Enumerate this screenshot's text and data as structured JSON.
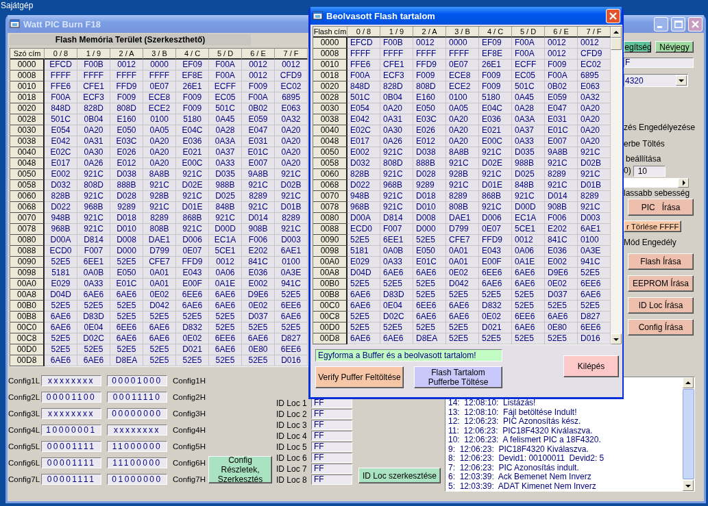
{
  "desktop": {
    "icon_label": "Sajátgép"
  },
  "main_window": {
    "title": "Watt PIC Burn F18",
    "active": false,
    "flash_area": {
      "title": "Flash Memória Terület (Szerkeszthető)",
      "columns": [
        "Szó cím",
        "0 / 8",
        "1 / 9",
        "2 / A",
        "3 / B",
        "4 / C",
        "5 / D",
        "6 / E",
        "7 / F"
      ],
      "rows": [
        {
          "cells": [
            "0000",
            "EFCD",
            "F00B",
            "0012",
            "0000",
            "EF09",
            "F00A",
            "0012",
            "0012"
          ]
        },
        {
          "cells": [
            "0008",
            "FFFF",
            "FFFF",
            "FFFF",
            "FFFF",
            "EF8E",
            "F00A",
            "0012",
            "CFD9"
          ]
        },
        {
          "cells": [
            "0010",
            "FFE6",
            "CFE1",
            "FFD9",
            "0E07",
            "26E1",
            "ECFF",
            "F009",
            "EC02"
          ]
        },
        {
          "cells": [
            "0018",
            "F00A",
            "ECF3",
            "F009",
            "ECE8",
            "F009",
            "EC05",
            "F00A",
            "6895"
          ]
        },
        {
          "cells": [
            "0020",
            "848D",
            "828D",
            "808D",
            "ECE2",
            "F009",
            "501C",
            "0B02",
            "E063"
          ]
        },
        {
          "cells": [
            "0028",
            "501C",
            "0B04",
            "E160",
            "0100",
            "5180",
            "0A45",
            "E059",
            "0A32"
          ]
        },
        {
          "cells": [
            "0030",
            "E054",
            "0A20",
            "E050",
            "0A05",
            "E04C",
            "0A28",
            "E047",
            "0A20"
          ]
        },
        {
          "cells": [
            "0038",
            "E042",
            "0A31",
            "E03C",
            "0A20",
            "E036",
            "0A3A",
            "E031",
            "0A20"
          ]
        },
        {
          "cells": [
            "0040",
            "E02C",
            "0A30",
            "E026",
            "0A20",
            "E021",
            "0A37",
            "E01C",
            "0A20"
          ]
        },
        {
          "cells": [
            "0048",
            "E017",
            "0A26",
            "E012",
            "0A20",
            "E00C",
            "0A33",
            "E007",
            "0A20"
          ]
        },
        {
          "cells": [
            "0050",
            "E002",
            "921C",
            "D038",
            "8A8B",
            "921C",
            "D035",
            "9A8B",
            "921C"
          ]
        },
        {
          "cells": [
            "0058",
            "D032",
            "808D",
            "888B",
            "921C",
            "D02E",
            "988B",
            "921C",
            "D02B"
          ]
        },
        {
          "cells": [
            "0060",
            "828B",
            "921C",
            "D028",
            "928B",
            "921C",
            "D025",
            "8289",
            "921C"
          ]
        },
        {
          "cells": [
            "0068",
            "D022",
            "968B",
            "9289",
            "921C",
            "D01E",
            "848B",
            "921C",
            "D01B"
          ]
        },
        {
          "cells": [
            "0070",
            "948B",
            "921C",
            "D018",
            "8289",
            "868B",
            "921C",
            "D014",
            "8289"
          ]
        },
        {
          "cells": [
            "0078",
            "968B",
            "921C",
            "D010",
            "808B",
            "921C",
            "D00D",
            "908B",
            "921C"
          ]
        },
        {
          "cells": [
            "0080",
            "D00A",
            "D814",
            "D008",
            "DAE1",
            "D006",
            "EC1A",
            "F006",
            "D003"
          ]
        },
        {
          "cells": [
            "0088",
            "ECD0",
            "F007",
            "D000",
            "D799",
            "0E07",
            "5CE1",
            "E202",
            "6AE1"
          ]
        },
        {
          "cells": [
            "0090",
            "52E5",
            "6EE1",
            "52E5",
            "CFE7",
            "FFD9",
            "0012",
            "841C",
            "0100"
          ]
        },
        {
          "cells": [
            "0098",
            "5181",
            "0A0B",
            "E050",
            "0A01",
            "E043",
            "0A06",
            "E036",
            "0A3E"
          ]
        },
        {
          "cells": [
            "00A0",
            "E029",
            "0A33",
            "E01C",
            "0A01",
            "E00F",
            "0A1E",
            "E002",
            "941C"
          ]
        },
        {
          "cells": [
            "00A8",
            "D04D",
            "6AE6",
            "6AE6",
            "0E02",
            "6EE6",
            "6AE6",
            "D9E6",
            "52E5"
          ]
        },
        {
          "cells": [
            "00B0",
            "52E5",
            "52E5",
            "52E5",
            "D042",
            "6AE6",
            "6AE6",
            "0E02",
            "6EE6"
          ]
        },
        {
          "cells": [
            "00B8",
            "6AE6",
            "D83D",
            "52E5",
            "52E5",
            "52E5",
            "52E5",
            "D037",
            "6AE6"
          ]
        },
        {
          "cells": [
            "00C0",
            "6AE6",
            "0E04",
            "6EE6",
            "6AE6",
            "D832",
            "52E5",
            "52E5",
            "52E5"
          ]
        },
        {
          "cells": [
            "00C8",
            "52E5",
            "D02C",
            "6AE6",
            "6AE6",
            "0E02",
            "6EE6",
            "6AE6",
            "D827"
          ]
        },
        {
          "cells": [
            "00D0",
            "52E5",
            "52E5",
            "52E5",
            "52E5",
            "D021",
            "6AE6",
            "0E80",
            "6EE6"
          ]
        },
        {
          "cells": [
            "00D8",
            "6AE6",
            "6AE6",
            "D8EA",
            "52E5",
            "52E5",
            "52E5",
            "52E5",
            "D016"
          ]
        }
      ]
    },
    "side_panel": {
      "help_button": "egítség",
      "about_button": "Névjegy",
      "path_field": "F",
      "device_select": "4320",
      "option_1": "zés Engedélyezése",
      "option_2": "erbe Töltés",
      "speed_label": "beállítása",
      "speed_sublabel": "0)",
      "speed_field": "10",
      "speed_note": "lassabb sebesség",
      "pic_write_button": "PIC   Írása",
      "erase_button": "r Törlése FFFF",
      "mode_label": "Mód Engedély",
      "write_buttons": [
        "Flash Írása",
        "EEPROM Írása",
        "ID Loc Írása",
        "Config Írása"
      ]
    },
    "config_rows": [
      {
        "low_label": "Config1L",
        "low_value": "xxxxxxxx",
        "high_value": "00001000",
        "high_label": "Config1H"
      },
      {
        "low_label": "Config2L",
        "low_value": "00001100",
        "high_value": "00011110",
        "high_label": "Config2H"
      },
      {
        "low_label": "Config3L",
        "low_value": "xxxxxxxx",
        "high_value": "00000000",
        "high_label": "Config3H"
      },
      {
        "low_label": "Config4L",
        "low_value": "10000001",
        "high_value": "xxxxxxxx",
        "high_label": "Config4H"
      },
      {
        "low_label": "Config5L",
        "low_value": "00001111",
        "high_value": "11000000",
        "high_label": "Config5H"
      },
      {
        "low_label": "Config6L",
        "low_value": "00001111",
        "high_value": "11100000",
        "high_label": "Config6H"
      },
      {
        "low_label": "Config7L",
        "low_value": "00001111",
        "high_value": "01000000",
        "high_label": "Config7H"
      }
    ],
    "config_button": "Config Részletek, Szerkesztés",
    "id_locs": [
      {
        "label": "ID Loc 1",
        "value": "FF"
      },
      {
        "label": "ID Loc 2",
        "value": "FF"
      },
      {
        "label": "ID Loc 3",
        "value": "FF"
      },
      {
        "label": "ID Loc 4",
        "value": "FF"
      },
      {
        "label": "ID Loc 5",
        "value": "FF"
      },
      {
        "label": "ID Loc 6",
        "value": "FF"
      },
      {
        "label": "ID Loc 7",
        "value": "FF"
      },
      {
        "label": "ID Loc 8",
        "value": "FF"
      }
    ],
    "id_loc_button": "ID Loc szerkesztése",
    "log": [
      "14:  12:08:10:  Listázás!",
      "13:  12:08:10:  Fájl betöltése Indult!",
      "12:  12:06:23:  PIC Azonosítás kész.",
      "11:  12:06:23:  PIC18F4320 Kiválaszva.",
      "10:  12:06:23:  A felismert PIC a 18F4320.",
      "9:  12:06:23:  PIC18F4320 Kiválaszva.",
      "8:  12:06:23:  Devid1: 00100011  Devid2: 5",
      "7:  12:06:23:  PIC Azonosítás indult.",
      "6:  12:03:39:  Ack Bemenet Nem Inverz",
      "5:  12:03:39:  ADAT Kimenet Nem Inverz"
    ]
  },
  "dialog": {
    "title": "Beolvasott Flash tartalom",
    "active": true,
    "table": {
      "columns": [
        "Flash cím",
        "0 / 8",
        "1 / 9",
        "2 / A",
        "3 / B",
        "4 / C",
        "5 / D",
        "6 / E",
        "7 / F"
      ],
      "rows": [
        {
          "cells": [
            "0000",
            "EFCD",
            "F00B",
            "0012",
            "0000",
            "EF09",
            "F00A",
            "0012",
            "0012"
          ]
        },
        {
          "cells": [
            "0008",
            "FFFF",
            "FFFF",
            "FFFF",
            "FFFF",
            "EF8E",
            "F00A",
            "0012",
            "CFD9"
          ]
        },
        {
          "cells": [
            "0010",
            "FFE6",
            "CFE1",
            "FFD9",
            "0E07",
            "26E1",
            "ECFF",
            "F009",
            "EC02"
          ]
        },
        {
          "cells": [
            "0018",
            "F00A",
            "ECF3",
            "F009",
            "ECE8",
            "F009",
            "EC05",
            "F00A",
            "6895"
          ]
        },
        {
          "cells": [
            "0020",
            "848D",
            "828D",
            "808D",
            "ECE2",
            "F009",
            "501C",
            "0B02",
            "E063"
          ]
        },
        {
          "cells": [
            "0028",
            "501C",
            "0B04",
            "E160",
            "0100",
            "5180",
            "0A45",
            "E059",
            "0A32"
          ]
        },
        {
          "cells": [
            "0030",
            "E054",
            "0A20",
            "E050",
            "0A05",
            "E04C",
            "0A28",
            "E047",
            "0A20"
          ]
        },
        {
          "cells": [
            "0038",
            "E042",
            "0A31",
            "E03C",
            "0A20",
            "E036",
            "0A3A",
            "E031",
            "0A20"
          ]
        },
        {
          "cells": [
            "0040",
            "E02C",
            "0A30",
            "E026",
            "0A20",
            "E021",
            "0A37",
            "E01C",
            "0A20"
          ]
        },
        {
          "cells": [
            "0048",
            "E017",
            "0A26",
            "E012",
            "0A20",
            "E00C",
            "0A33",
            "E007",
            "0A20"
          ]
        },
        {
          "cells": [
            "0050",
            "E002",
            "921C",
            "D038",
            "8A8B",
            "921C",
            "D035",
            "9A8B",
            "921C"
          ]
        },
        {
          "cells": [
            "0058",
            "D032",
            "808D",
            "888B",
            "921C",
            "D02E",
            "988B",
            "921C",
            "D02B"
          ]
        },
        {
          "cells": [
            "0060",
            "828B",
            "921C",
            "D028",
            "928B",
            "921C",
            "D025",
            "8289",
            "921C"
          ]
        },
        {
          "cells": [
            "0068",
            "D022",
            "968B",
            "9289",
            "921C",
            "D01E",
            "848B",
            "921C",
            "D01B"
          ]
        },
        {
          "cells": [
            "0070",
            "948B",
            "921C",
            "D018",
            "8289",
            "868B",
            "921C",
            "D014",
            "8289"
          ]
        },
        {
          "cells": [
            "0078",
            "968B",
            "921C",
            "D010",
            "808B",
            "921C",
            "D00D",
            "908B",
            "921C"
          ]
        },
        {
          "cells": [
            "0080",
            "D00A",
            "D814",
            "D008",
            "DAE1",
            "D006",
            "EC1A",
            "F006",
            "D003"
          ]
        },
        {
          "cells": [
            "0088",
            "ECD0",
            "F007",
            "D000",
            "D799",
            "0E07",
            "5CE1",
            "E202",
            "6AE1"
          ]
        },
        {
          "cells": [
            "0090",
            "52E5",
            "6EE1",
            "52E5",
            "CFE7",
            "FFD9",
            "0012",
            "841C",
            "0100"
          ]
        },
        {
          "cells": [
            "0098",
            "5181",
            "0A0B",
            "E050",
            "0A01",
            "E043",
            "0A06",
            "E036",
            "0A3E"
          ]
        },
        {
          "cells": [
            "00A0",
            "E029",
            "0A33",
            "E01C",
            "0A01",
            "E00F",
            "0A1E",
            "E002",
            "941C"
          ]
        },
        {
          "cells": [
            "00A8",
            "D04D",
            "6AE6",
            "6AE6",
            "0E02",
            "6EE6",
            "6AE6",
            "D9E6",
            "52E5"
          ]
        },
        {
          "cells": [
            "00B0",
            "52E5",
            "52E5",
            "52E5",
            "D042",
            "6AE6",
            "6AE6",
            "0E02",
            "6EE6"
          ]
        },
        {
          "cells": [
            "00B8",
            "6AE6",
            "D83D",
            "52E5",
            "52E5",
            "52E5",
            "52E5",
            "D037",
            "6AE6"
          ]
        },
        {
          "cells": [
            "00C0",
            "6AE6",
            "0E04",
            "6EE6",
            "6AE6",
            "D832",
            "52E5",
            "52E5",
            "52E5"
          ]
        },
        {
          "cells": [
            "00C8",
            "52E5",
            "D02C",
            "6AE6",
            "6AE6",
            "0E02",
            "6EE6",
            "6AE6",
            "D827"
          ]
        },
        {
          "cells": [
            "00D0",
            "52E5",
            "52E5",
            "52E5",
            "52E5",
            "D021",
            "6AE6",
            "0E80",
            "6EE6"
          ]
        },
        {
          "cells": [
            "00D8",
            "6AE6",
            "6AE6",
            "D8EA",
            "52E5",
            "52E5",
            "52E5",
            "52E5",
            "D016"
          ]
        }
      ]
    },
    "message": "Egyforma a Buffer és a beolvasott tartalom!",
    "buttons": [
      {
        "kind": "verify",
        "label": "Verify Puffer Feltöltése"
      },
      {
        "kind": "load",
        "label": "Flash Tartalom Pufferbe Töltése"
      },
      {
        "kind": "exit",
        "label": "Kilépés"
      }
    ]
  }
}
